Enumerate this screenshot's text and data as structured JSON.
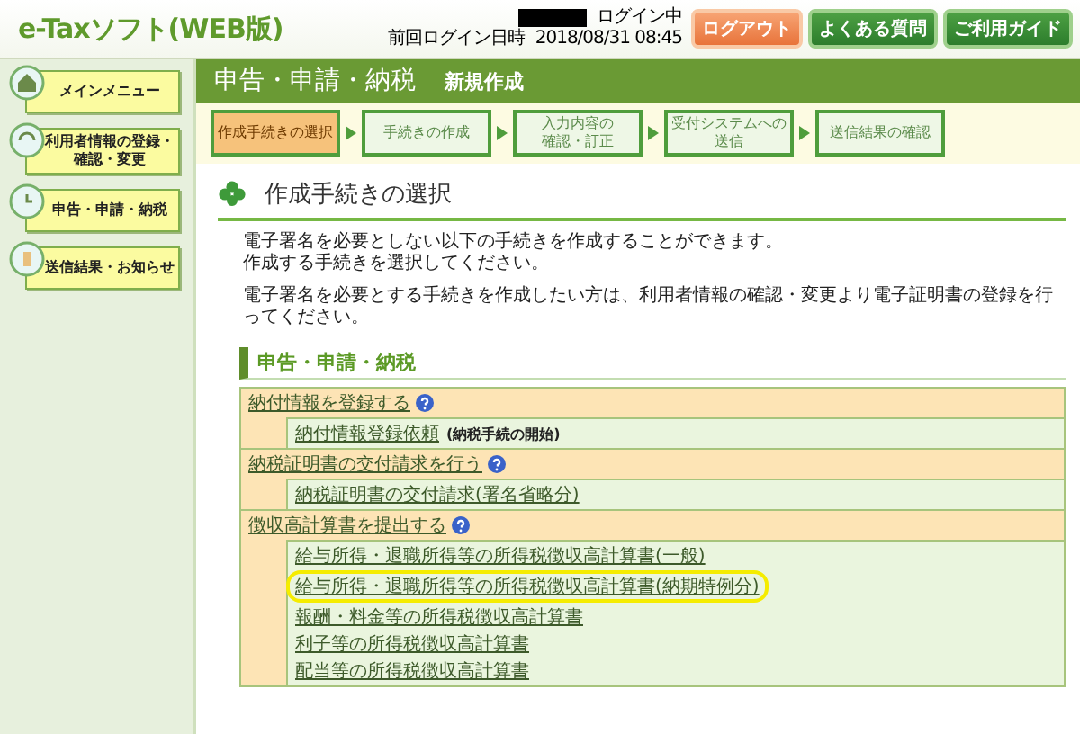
{
  "header": {
    "logo": "e-Taxソフト(WEB版)",
    "login_status": "ログイン中",
    "last_login_label": "前回ログイン日時",
    "last_login_time": "2018/08/31 08:45",
    "buttons": [
      {
        "label": "ログアウト",
        "kind": "logout"
      },
      {
        "label": "よくある質問",
        "kind": "nav"
      },
      {
        "label": "ご利用ガイド",
        "kind": "nav"
      }
    ]
  },
  "sidebar": {
    "items": [
      {
        "label": "メインメニュー"
      },
      {
        "label": "利用者情報の登録・確認・変更"
      },
      {
        "label": "申告・申請・納税"
      },
      {
        "label": "送信結果・お知らせ"
      }
    ]
  },
  "title_bar": {
    "title": "申告・申請・納税",
    "subtitle": "新規作成"
  },
  "steps": [
    {
      "lines": [
        "作成手続きの選択"
      ],
      "selected": true
    },
    {
      "lines": [
        "手続きの作成"
      ],
      "selected": false
    },
    {
      "lines": [
        "入力内容の",
        "確認・訂正"
      ],
      "selected": false
    },
    {
      "lines": [
        "受付システムへの",
        "送信"
      ],
      "selected": false
    },
    {
      "lines": [
        "送信結果の確認"
      ],
      "selected": false
    }
  ],
  "content": {
    "heading": "作成手続きの選択",
    "paragraphs": [
      [
        "電子署名を必要としない以下の手続きを作成することができます。",
        "作成する手続きを選択してください。"
      ],
      [
        "電子署名を必要とする手続きを作成したい方は、利用者情報の確認・変更より電子証明書の登録を行ってください。"
      ]
    ],
    "section_title": "申告・申請・納税",
    "groups": [
      {
        "title": "納付情報を登録する",
        "items": [
          {
            "label": "納付情報登録依頼",
            "note": "(納税手続の開始)",
            "highlighted": false
          }
        ]
      },
      {
        "title": "納税証明書の交付請求を行う",
        "items": [
          {
            "label": "納税証明書の交付請求(署名省略分)",
            "highlighted": false
          }
        ]
      },
      {
        "title": "徴収高計算書を提出する",
        "items": [
          {
            "label": "給与所得・退職所得等の所得税徴収高計算書(一般)",
            "highlighted": false
          },
          {
            "label": "給与所得・退職所得等の所得税徴収高計算書(納期特例分)",
            "highlighted": true
          },
          {
            "label": "報酬・料金等の所得税徴収高計算書",
            "highlighted": false
          },
          {
            "label": "利子等の所得税徴収高計算書",
            "highlighted": false
          },
          {
            "label": "配当等の所得税徴収高計算書",
            "highlighted": false
          }
        ]
      }
    ]
  }
}
